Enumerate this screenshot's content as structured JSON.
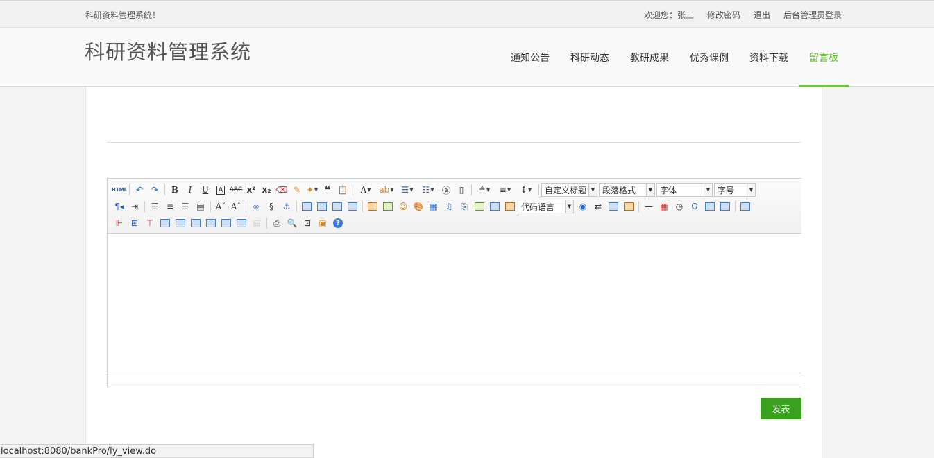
{
  "topbar": {
    "site_name": "科研资料管理系统！",
    "welcome": "欢迎您：张三",
    "change_password": "修改密码",
    "logout": "退出",
    "admin_login": "后台管理员登录"
  },
  "header": {
    "logo": "科研资料管理系统",
    "nav": [
      {
        "label": "通知公告",
        "active": false
      },
      {
        "label": "科研动态",
        "active": false
      },
      {
        "label": "教研成果",
        "active": false
      },
      {
        "label": "优秀课例",
        "active": false
      },
      {
        "label": "资料下载",
        "active": false
      },
      {
        "label": "留言板",
        "active": true
      }
    ]
  },
  "editor": {
    "combos": {
      "custom_title": "自定义标题",
      "paragraph": "段落格式",
      "font": "字体",
      "size": "字号",
      "code_lang": "代码语言"
    },
    "html_label": "HTML"
  },
  "submit_label": "发表",
  "status_url": "localhost:8080/bankPro/ly_view.do",
  "colors": {
    "accent": "#5db52d",
    "button": "#3aa11f"
  }
}
